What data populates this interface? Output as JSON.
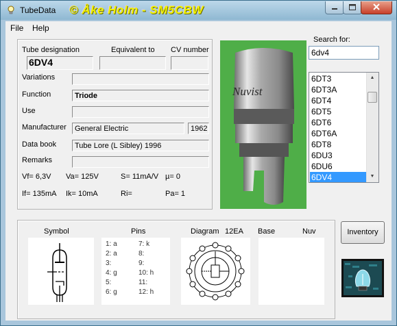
{
  "window": {
    "title": "TubeData",
    "credit": "© Åke Holm - SM5CBW"
  },
  "menu": {
    "file": "File",
    "help": "Help"
  },
  "form": {
    "tube_designation_label": "Tube designation",
    "equivalent_label": "Equivalent to",
    "cv_label": "CV number",
    "tube_designation": "6DV4",
    "equivalent": "",
    "cv_number": "",
    "variations_label": "Variations",
    "variations": "",
    "function_label": "Function",
    "function": "Triode",
    "use_label": "Use",
    "use": "",
    "manufacturer_label": "Manufacturer",
    "manufacturer": "General Electric",
    "year": "1962",
    "data_book_label": "Data book",
    "data_book": "Tube Lore (L Sibley) 1996",
    "remarks_label": "Remarks",
    "remarks": ""
  },
  "specs": {
    "vf": "Vf= 6,3V",
    "va": "Va= 125V",
    "s": "S= 11mA/V",
    "mu": "µ=    0",
    "if": "If= 135mA",
    "ik": "Ik=   10mA",
    "ri": "Ri=",
    "pa": "Pa= 1"
  },
  "photo": {
    "text": "Nuvist"
  },
  "search": {
    "label": "Search for:",
    "value": "6dv4"
  },
  "list": {
    "items": [
      "6DT3",
      "6DT3A",
      "6DT4",
      "6DT5",
      "6DT6",
      "6DT6A",
      "6DT8",
      "6DU3",
      "6DU6",
      "6DV4"
    ],
    "selected": "6DV4"
  },
  "bottom": {
    "symbol_label": "Symbol",
    "pins_label": "Pins",
    "diagram_label": "Diagram",
    "diagram_code": "12EA",
    "base_label": "Base",
    "nuv_label": "Nuv",
    "pins": [
      {
        "a": "1: a",
        "b": "7: k"
      },
      {
        "a": "2: a",
        "b": "8:"
      },
      {
        "a": "3:",
        "b": "9:"
      },
      {
        "a": "4: g",
        "b": "10: h"
      },
      {
        "a": "5:",
        "b": "11:"
      },
      {
        "a": "6: g",
        "b": "12: h"
      }
    ]
  },
  "buttons": {
    "inventory": "Inventory"
  }
}
